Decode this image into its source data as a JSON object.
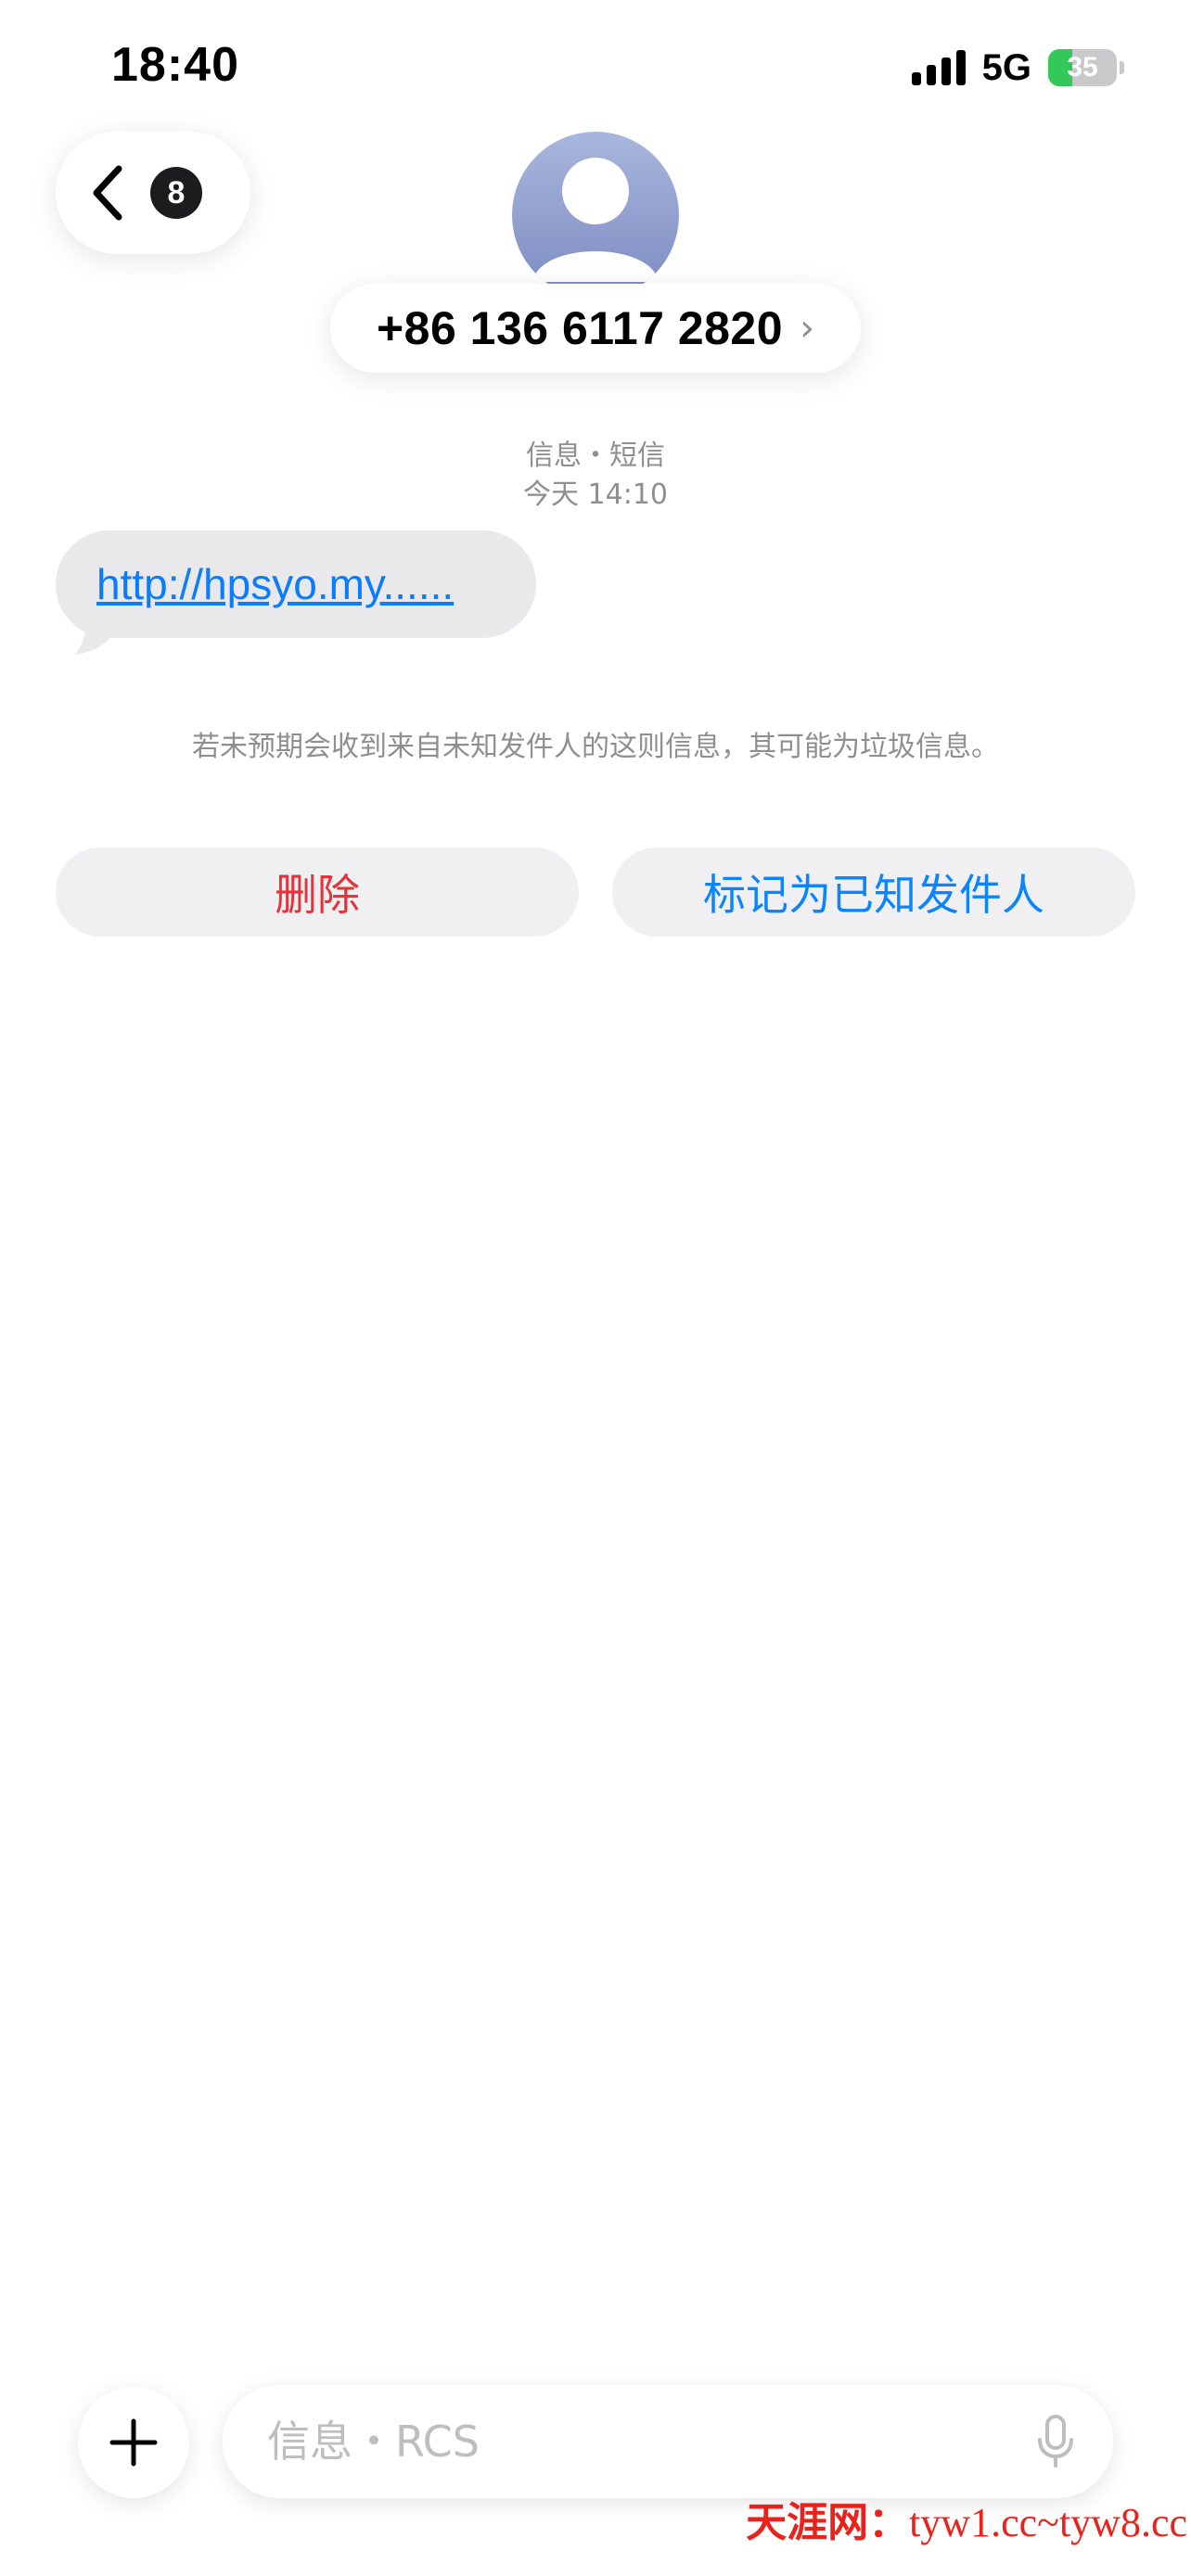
{
  "status_bar": {
    "time": "18:40",
    "network": "5G",
    "battery_level": "35",
    "battery_percent": 35,
    "battery_color": "#34c759"
  },
  "header": {
    "back_icon": "chevron-left-icon",
    "unread_badge": "8",
    "contact_avatar_icon": "person-icon",
    "contact_name": "+86 136 6117 2820",
    "contact_chevron": "›"
  },
  "conversation": {
    "service_label": "信息・短信",
    "timestamp": "今天 14:10",
    "messages": [
      {
        "direction": "incoming",
        "text": "http://hpsyo.my......"
      }
    ],
    "unknown_sender_warning": "若未预期会收到来自未知发件人的这则信息，其可能为垃圾信息。"
  },
  "actions": {
    "delete_label": "删除",
    "delete_color": "#e8323a",
    "mark_known_label": "标记为已知发件人",
    "mark_known_color": "#0a84ff"
  },
  "composer": {
    "add_icon": "plus-icon",
    "placeholder": "信息・RCS",
    "value": "",
    "mic_icon": "microphone-icon"
  },
  "watermark": {
    "brand": "天涯网：",
    "domain": "tyw1.cc~tyw8.cc"
  }
}
